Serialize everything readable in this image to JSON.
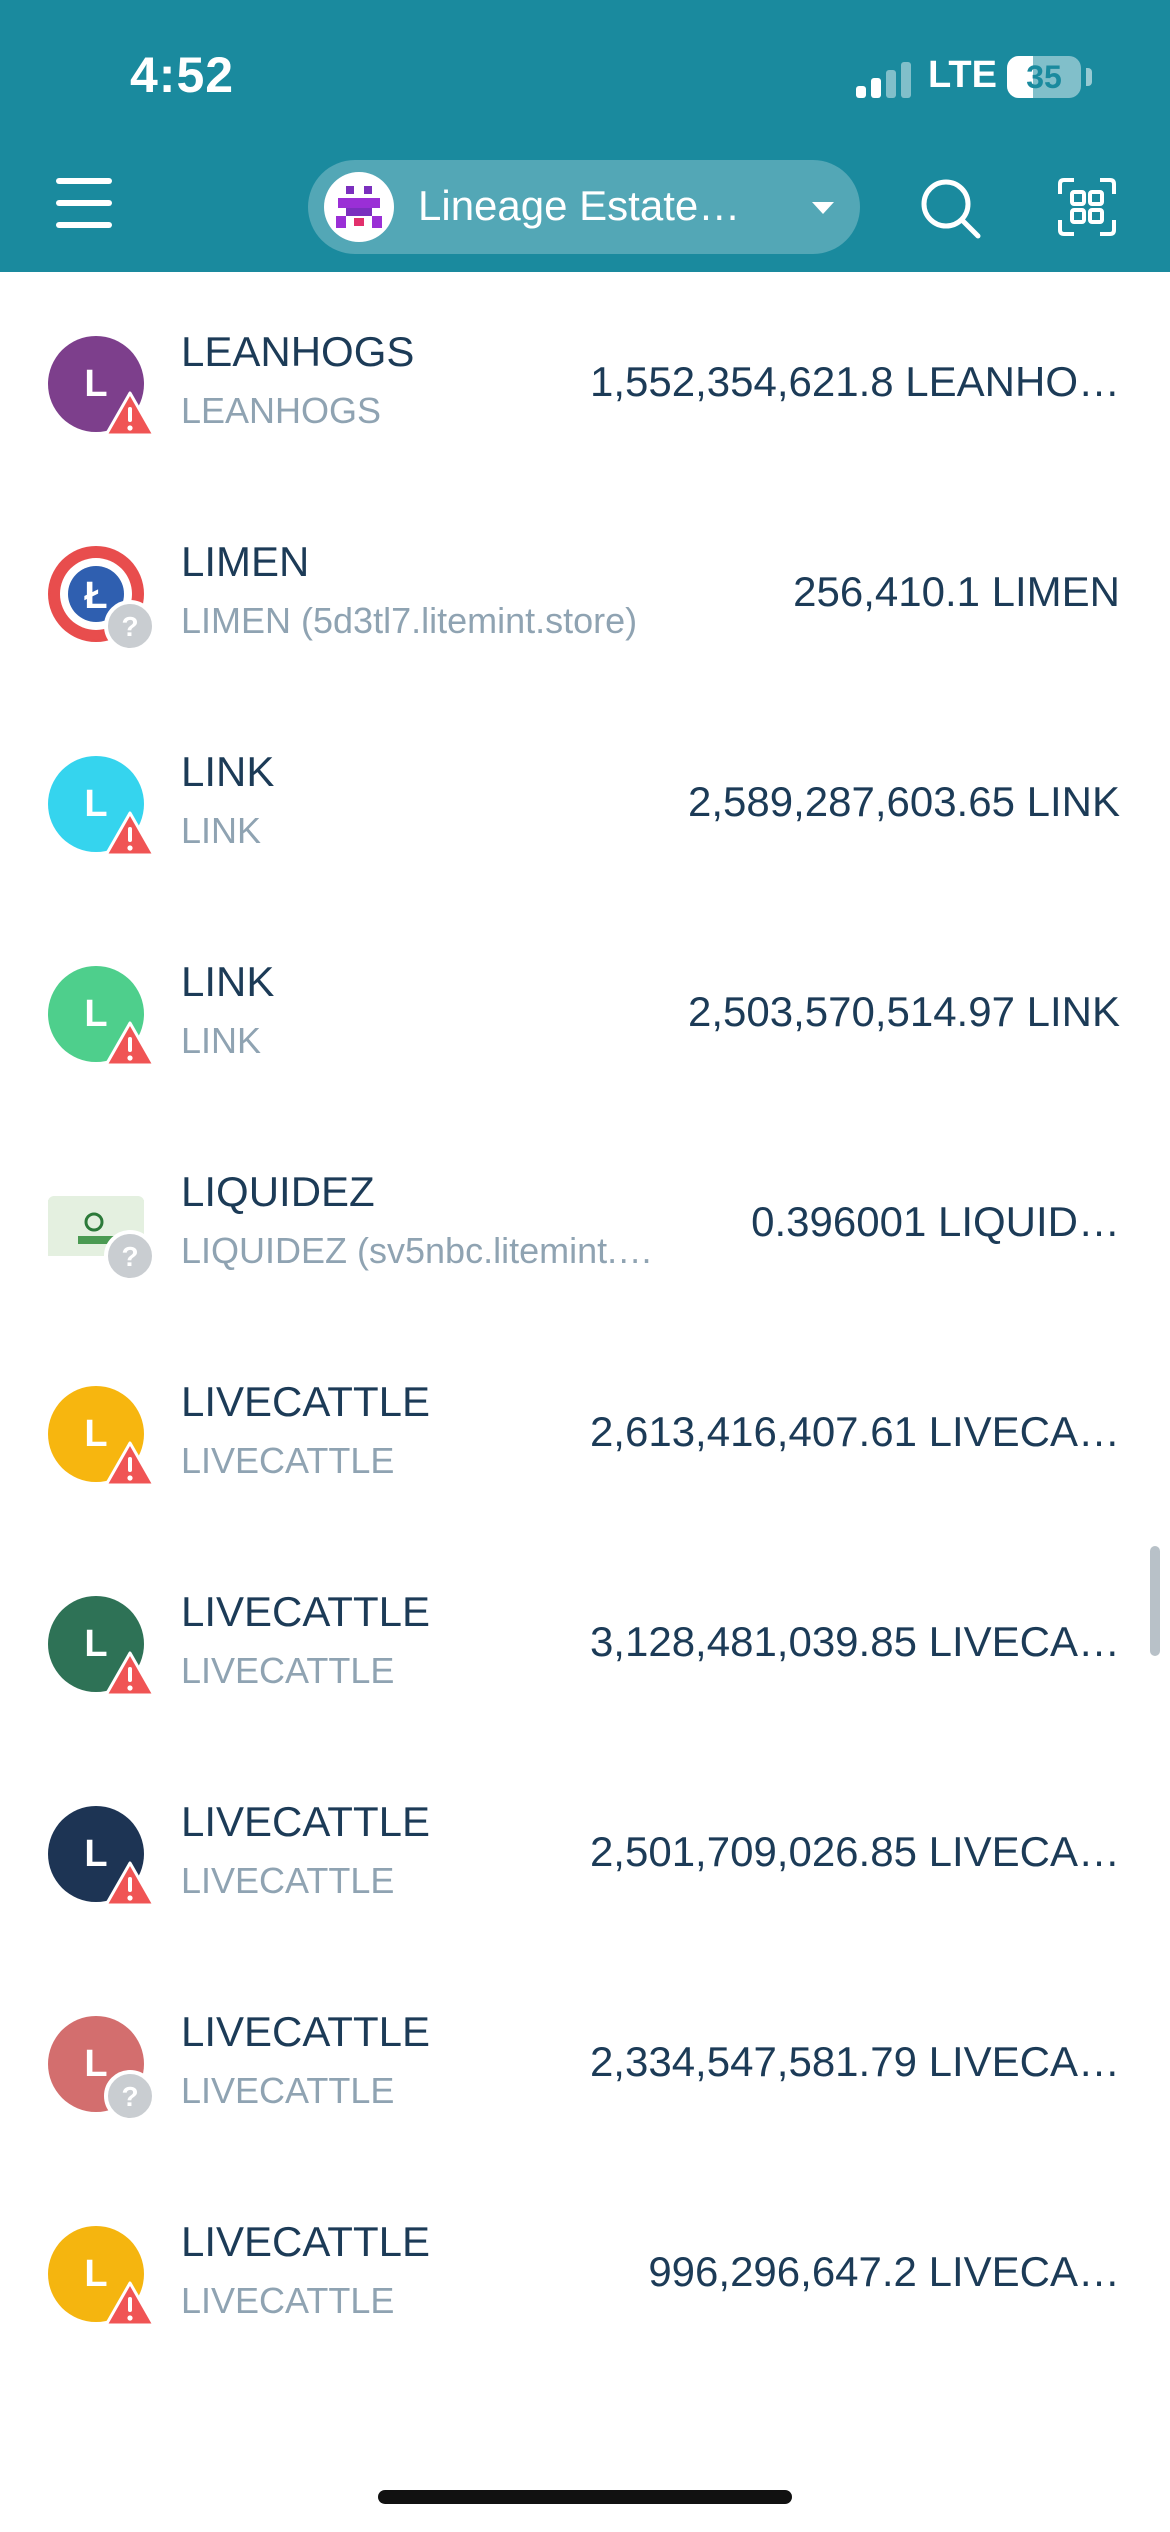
{
  "status_bar": {
    "time": "4:52",
    "network": "LTE",
    "battery": "35",
    "battery_level_percent": 35
  },
  "header": {
    "network_selector": "Lineage Estate…",
    "icons": [
      "menu-icon",
      "search-icon",
      "scan-icon"
    ]
  },
  "colors": {
    "header_bg": "#1a8a9e",
    "title_text": "#1c3b57",
    "subtitle_text": "#8fa3b2",
    "warning_badge": "#f05454"
  },
  "tokens": [
    {
      "name": "LEANHOGS",
      "sub": "LEANHOGS",
      "amount": "1,552,354,621.8 LEANHO…",
      "icon_letter": "L",
      "icon_color": "#7d3f8c",
      "badge": "warning"
    },
    {
      "name": "LIMEN",
      "sub": "LIMEN (5d3tl7.litemint.store)",
      "amount": "256,410.1 LIMEN",
      "icon_letter": "",
      "icon_color": "#e84d4d",
      "badge": "unknown"
    },
    {
      "name": "LINK",
      "sub": "LINK",
      "amount": "2,589,287,603.65 LINK",
      "icon_letter": "L",
      "icon_color": "#35d4ee",
      "badge": "warning"
    },
    {
      "name": "LINK",
      "sub": "LINK",
      "amount": "2,503,570,514.97 LINK",
      "icon_letter": "L",
      "icon_color": "#4ecf8c",
      "badge": "warning"
    },
    {
      "name": "LIQUIDEZ",
      "sub": "LIQUIDEZ (sv5nbc.litemint.…",
      "amount": "0.396001 LIQUID…",
      "icon_letter": "",
      "icon_color": "#e4f0e0",
      "badge": "unknown"
    },
    {
      "name": "LIVECATTLE",
      "sub": "LIVECATTLE",
      "amount": "2,613,416,407.61 LIVECA…",
      "icon_letter": "L",
      "icon_color": "#f7b60f",
      "badge": "warning"
    },
    {
      "name": "LIVECATTLE",
      "sub": "LIVECATTLE",
      "amount": "3,128,481,039.85 LIVECA…",
      "icon_letter": "L",
      "icon_color": "#2e7256",
      "badge": "warning"
    },
    {
      "name": "LIVECATTLE",
      "sub": "LIVECATTLE",
      "amount": "2,501,709,026.85 LIVECA…",
      "icon_letter": "L",
      "icon_color": "#1d3454",
      "badge": "warning"
    },
    {
      "name": "LIVECATTLE",
      "sub": "LIVECATTLE",
      "amount": "2,334,547,581.79 LIVECA…",
      "icon_letter": "L",
      "icon_color": "#d36e6e",
      "badge": "unknown"
    },
    {
      "name": "LIVECATTLE",
      "sub": "LIVECATTLE",
      "amount": "996,296,647.2 LIVECA…",
      "icon_letter": "L",
      "icon_color": "#f5b50f",
      "badge": "warning"
    }
  ]
}
